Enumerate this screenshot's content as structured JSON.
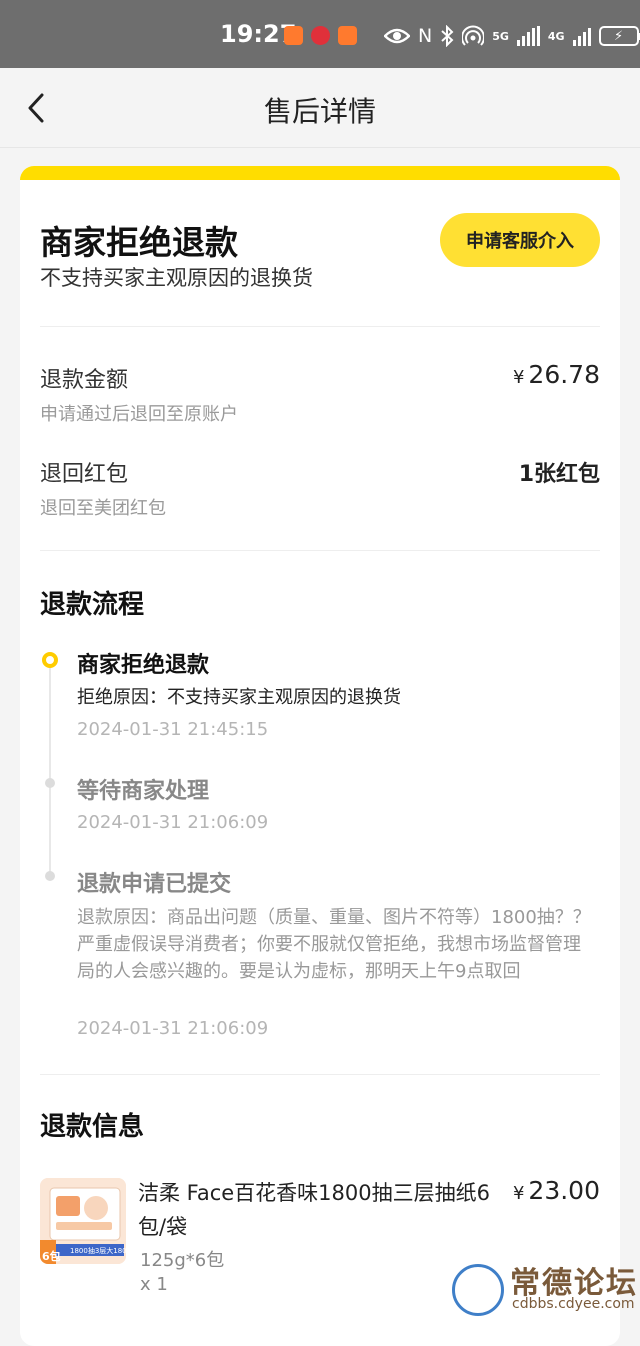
{
  "status_bar": {
    "time": "19:27",
    "network_5g": "5G",
    "network_4g": "4G",
    "icons": [
      "app-notification-icon",
      "app-notification-icon",
      "app-notification-icon",
      "eye-icon",
      "nfc-icon",
      "bluetooth-icon",
      "hotspot-icon",
      "signal-icon",
      "signal-icon",
      "battery-icon"
    ]
  },
  "header": {
    "title": "售后详情",
    "back_icon": "chevron-left-icon"
  },
  "status": {
    "title": "商家拒绝退款",
    "subtitle": "不支持买家主观原因的退换货",
    "cs_button": "申请客服介入"
  },
  "refund": {
    "amount_label": "退款金额",
    "amount_sub": "申请通过后退回至原账户",
    "currency": "¥",
    "amount_value": "26.78",
    "redpacket_label": "退回红包",
    "redpacket_sub": "退回至美团红包",
    "redpacket_value": "1张红包"
  },
  "process": {
    "title": "退款流程",
    "steps": [
      {
        "title": "商家拒绝退款",
        "detail": "拒绝原因：不支持买家主观原因的退换货",
        "time": "2024-01-31 21:45:15"
      },
      {
        "title": "等待商家处理",
        "time": "2024-01-31 21:06:09"
      },
      {
        "title": "退款申请已提交",
        "detail": "退款原因：商品出问题（质量、重量、图片不符等）1800抽？？严重虚假误导消费者；你要不服就仅管拒绝，我想市场监督管理局的人会感兴趣的。要是认为虚标，那明天上午9点取回",
        "time": "2024-01-31 21:06:09"
      }
    ]
  },
  "refund_info": {
    "title": "退款信息",
    "product": {
      "name": "洁柔 Face百花香味1800抽三层抽纸6包/袋",
      "spec": "125g*6包",
      "qty": "x 1",
      "currency": "¥",
      "price": "23.00",
      "thumb_badge": "6包",
      "thumb_banner": "1800抽3层大1800张"
    }
  },
  "watermark": {
    "title": "常德论坛",
    "url": "cdbbs.cdyee.com"
  },
  "colors": {
    "accent_yellow": "#ffdd00",
    "button_yellow": "#ffe033",
    "status_bar_bg": "#6e6e6e",
    "page_bg": "#f4f4f4"
  }
}
